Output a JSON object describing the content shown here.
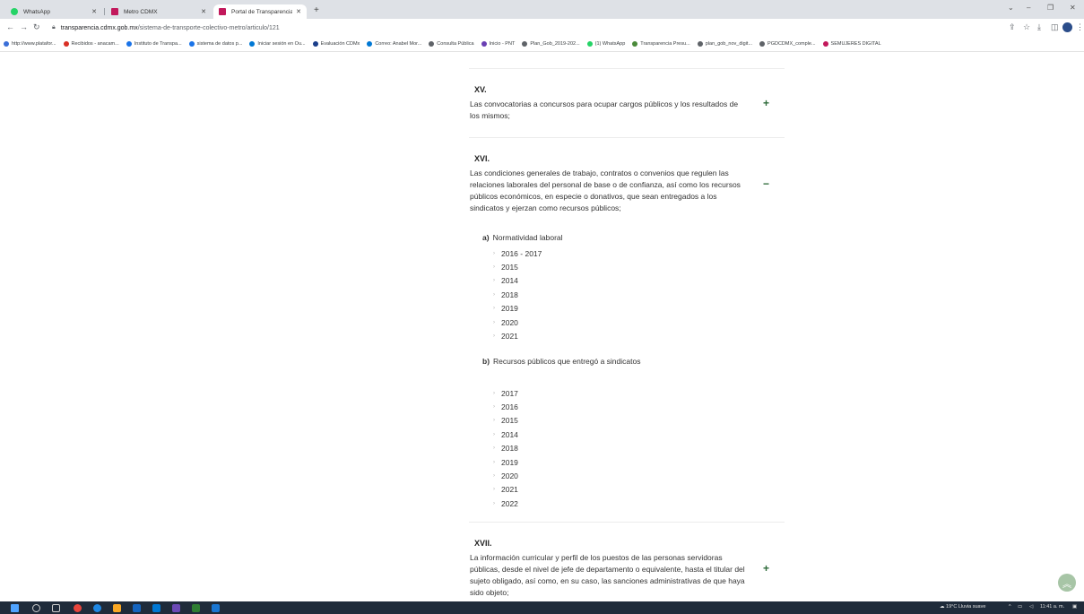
{
  "browser": {
    "tabs": [
      {
        "title": "WhatsApp",
        "favicon_color": "#25d366"
      },
      {
        "title": "Metro CDMX",
        "favicon_color": "#c2185b"
      },
      {
        "title": "Portal de Transparencia de la CD",
        "favicon_color": "#c2185b"
      }
    ],
    "url_domain": "transparencia.cdmx.gob.mx",
    "url_path": "/sistema-de-transporte-colectivo-metro/articulo/121",
    "bookmarks": [
      {
        "label": "http://www.platafor...",
        "color": "#3b6fd8"
      },
      {
        "label": "Recibidos - anacam...",
        "color": "#d93025"
      },
      {
        "label": "Instituto de Transpa...",
        "color": "#1a73e8"
      },
      {
        "label": "sistema de datos p...",
        "color": "#1a73e8"
      },
      {
        "label": "Iniciar sesión en Ou...",
        "color": "#0078d4"
      },
      {
        "label": "Evaluación CDMx",
        "color": "#1a3e8a"
      },
      {
        "label": "Correo: Anabel Mor...",
        "color": "#0078d4"
      },
      {
        "label": "Consulta Pública",
        "color": "#5f6368"
      },
      {
        "label": "Inicio - PNT",
        "color": "#6a3fb3"
      },
      {
        "label": "Plan_Gob_2019-202...",
        "color": "#5f6368"
      },
      {
        "label": "(1) WhatsApp",
        "color": "#25d366"
      },
      {
        "label": "Transparencia Presu...",
        "color": "#4a8a3a"
      },
      {
        "label": "plan_gob_nov_digit...",
        "color": "#5f6368"
      },
      {
        "label": "PGDCDMX_comple...",
        "color": "#5f6368"
      },
      {
        "label": "SEMUJERES DIGITAL",
        "color": "#c2185b"
      }
    ]
  },
  "sections": {
    "xv": {
      "number": "XV.",
      "text": "Las convocatorias a concursos para ocupar cargos públicos y los resultados de los mismos;",
      "toggle": "+"
    },
    "xvi": {
      "number": "XVI.",
      "text": "Las condiciones generales de trabajo, contratos o convenios que regulen las relaciones laborales del personal de base o de confianza, así como los recursos públicos económicos, en especie o donativos, que sean entregados a los sindicatos y ejerzan como recursos públicos;",
      "toggle": "−",
      "sub_a": {
        "letter": "a)",
        "title": "Normatividad laboral",
        "years": [
          "2016 - 2017",
          "2015",
          "2014",
          "2018",
          "2019",
          "2020",
          "2021"
        ]
      },
      "sub_b": {
        "letter": "b)",
        "title": "Recursos públicos que entregó a sindicatos",
        "years": [
          "2017",
          "2016",
          "2015",
          "2014",
          "2018",
          "2019",
          "2020",
          "2021",
          "2022"
        ]
      }
    },
    "xvii": {
      "number": "XVII.",
      "text": "La información curricular y perfil de los puestos de las personas servidoras públicas, desde el nivel de jefe de departamento o equivalente, hasta el titular del sujeto obligado, así como, en su caso, las sanciones administrativas de que haya sido objeto;",
      "toggle": "+"
    }
  },
  "taskbar": {
    "weather": "19°C Lluvia suave",
    "clock": "11:41 a. m."
  },
  "colors": {
    "accent_green": "#2e6b3a",
    "scroll_button": "#a7c5a6"
  }
}
